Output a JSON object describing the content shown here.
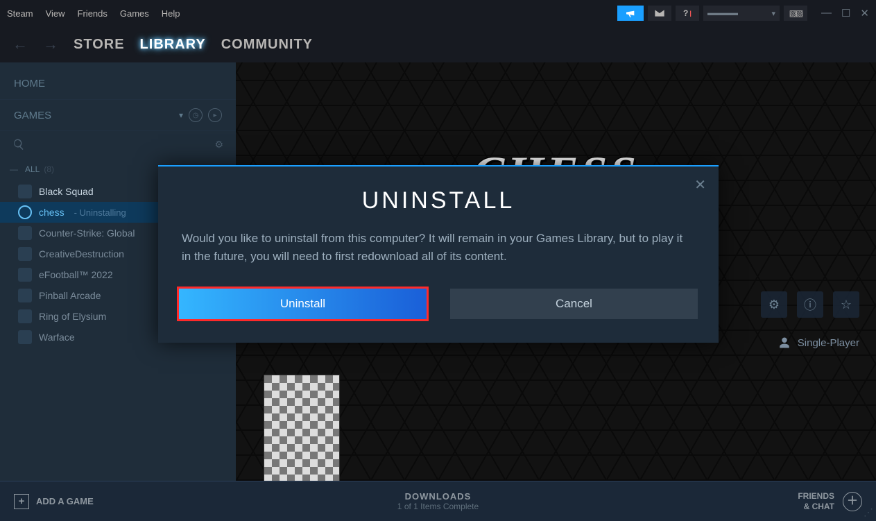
{
  "menus": {
    "steam": "Steam",
    "view": "View",
    "friends": "Friends",
    "games": "Games",
    "help": "Help"
  },
  "nav": {
    "store": "STORE",
    "library": "LIBRARY",
    "community": "COMMUNITY"
  },
  "sidebar": {
    "home": "HOME",
    "games_header": "GAMES",
    "category": "ALL",
    "category_count": "(8)",
    "items": [
      {
        "name": "Black Squad"
      },
      {
        "name": "chess",
        "status": "- Uninstalling"
      },
      {
        "name": "Counter-Strike: Global"
      },
      {
        "name": "CreativeDestruction"
      },
      {
        "name": "eFootball™ 2022"
      },
      {
        "name": "Pinball Arcade"
      },
      {
        "name": "Ring of Elysium"
      },
      {
        "name": "Warface"
      }
    ]
  },
  "content": {
    "hero": "CHESS",
    "tag": "Single-Player"
  },
  "modal": {
    "title": "UNINSTALL",
    "body": "Would you like to uninstall          from this computer? It will remain in your Games Library, but to play it in the future, you will need to first redownload all of its content.",
    "primary": "Uninstall",
    "secondary": "Cancel"
  },
  "bottom": {
    "add": "ADD A GAME",
    "downloads": "DOWNLOADS",
    "downloads_sub": "1 of 1 Items Complete",
    "friends": "FRIENDS\n& CHAT"
  }
}
